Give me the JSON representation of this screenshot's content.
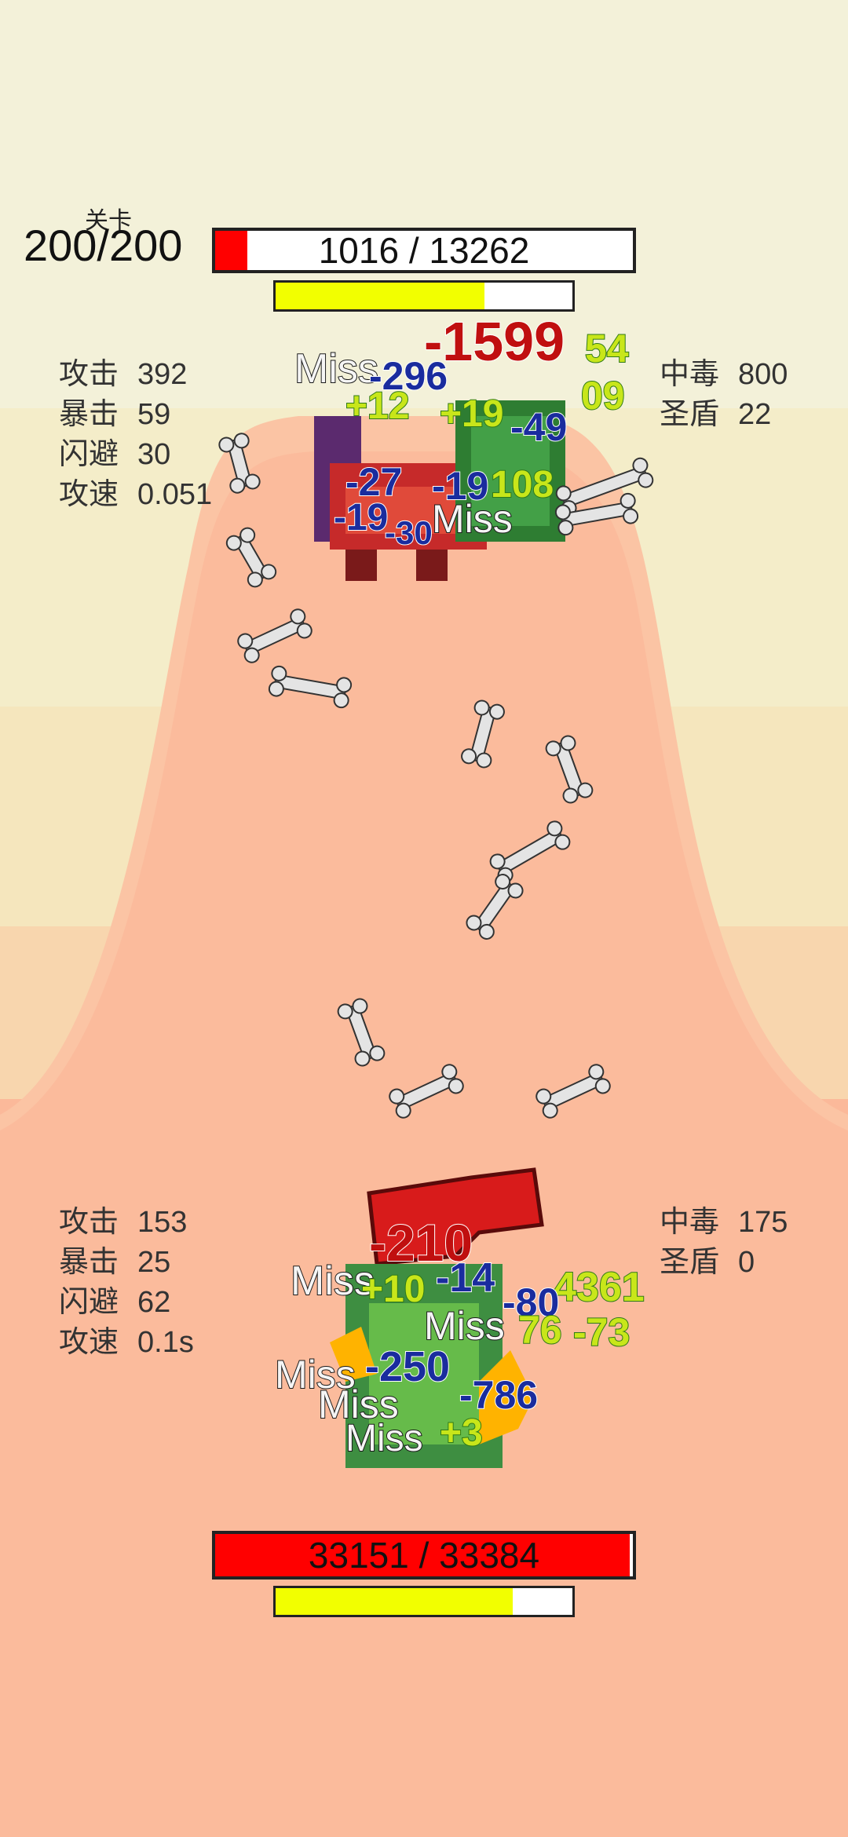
{
  "stage": {
    "label": "关卡",
    "value": "200/200"
  },
  "enemy": {
    "hp_text": "1016 / 13262",
    "hp_fraction": 0.077,
    "energy_fraction": 0.705,
    "stats": [
      {
        "key": "攻击",
        "value": "392"
      },
      {
        "key": "暴击",
        "value": "59"
      },
      {
        "key": "闪避",
        "value": "30"
      },
      {
        "key": "攻速",
        "value": "0.051"
      }
    ],
    "effects": [
      {
        "key": "中毒",
        "value": "800"
      },
      {
        "key": "圣盾",
        "value": "22"
      }
    ],
    "damage_numbers": [
      {
        "text": "-1599",
        "style": "red"
      },
      {
        "text": "Miss",
        "style": "miss"
      },
      {
        "text": "-296",
        "style": "blue"
      },
      {
        "text": "+12",
        "style": "green"
      },
      {
        "text": "+19",
        "style": "green"
      },
      {
        "text": "-49",
        "style": "blue"
      },
      {
        "text": "54",
        "style": "green"
      },
      {
        "text": "09",
        "style": "green"
      },
      {
        "text": "-27",
        "style": "blue"
      },
      {
        "text": "-19",
        "style": "blue"
      },
      {
        "text": "108",
        "style": "green"
      },
      {
        "text": "-19",
        "style": "blue"
      },
      {
        "text": "-30",
        "style": "blue"
      },
      {
        "text": "Miss",
        "style": "miss"
      }
    ]
  },
  "player": {
    "hp_text": "33151 / 33384",
    "hp_fraction": 0.993,
    "energy_fraction": 0.8,
    "stats": [
      {
        "key": "攻击",
        "value": "153"
      },
      {
        "key": "暴击",
        "value": "25"
      },
      {
        "key": "闪避",
        "value": "62"
      },
      {
        "key": "攻速",
        "value": "0.1s"
      }
    ],
    "effects": [
      {
        "key": "中毒",
        "value": "175"
      },
      {
        "key": "圣盾",
        "value": "0"
      }
    ],
    "damage_numbers": [
      {
        "text": "-210",
        "style": "red"
      },
      {
        "text": "Miss",
        "style": "miss"
      },
      {
        "text": "+10",
        "style": "green"
      },
      {
        "text": "-14",
        "style": "blue"
      },
      {
        "text": "4361",
        "style": "green"
      },
      {
        "text": "-80",
        "style": "blue"
      },
      {
        "text": "Miss",
        "style": "miss"
      },
      {
        "text": "76",
        "style": "green"
      },
      {
        "text": "-73",
        "style": "green"
      },
      {
        "text": "-250",
        "style": "blue"
      },
      {
        "text": "Miss",
        "style": "miss"
      },
      {
        "text": "Miss",
        "style": "miss"
      },
      {
        "text": "-786",
        "style": "blue"
      },
      {
        "text": "Miss",
        "style": "miss"
      },
      {
        "text": "+3",
        "style": "green"
      }
    ]
  },
  "colors": {
    "hp_red": "#ff0000",
    "energy_yellow": "#f2ff00",
    "bone": "#e4e4e4"
  }
}
